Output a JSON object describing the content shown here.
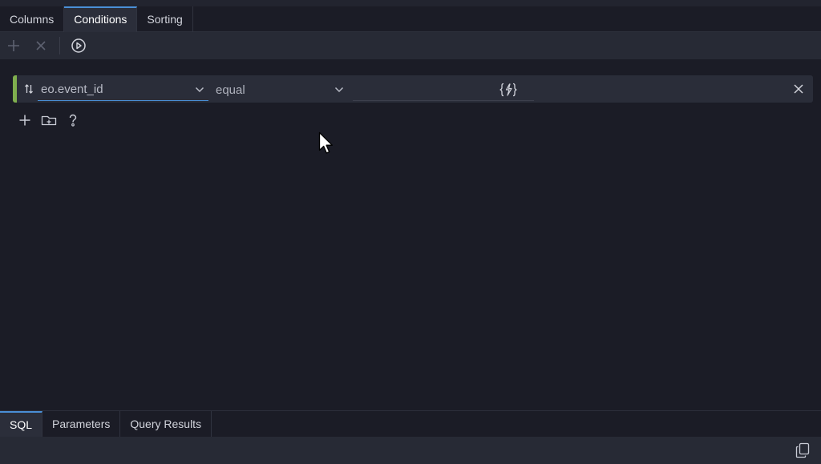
{
  "top_tabs": [
    {
      "label": "Columns",
      "active": false
    },
    {
      "label": "Conditions",
      "active": true
    },
    {
      "label": "Sorting",
      "active": false
    }
  ],
  "toolbar": {
    "add_icon": "plus-icon",
    "delete_icon": "close-icon",
    "run_icon": "play-circle-icon"
  },
  "condition": {
    "field": "eo.event_id",
    "operator": "equal",
    "value": "",
    "accent_color": "#7fae4e"
  },
  "actions": {
    "add_condition_icon": "plus-icon",
    "add_group_icon": "folder-plus-icon",
    "help_icon": "help-icon"
  },
  "bottom_tabs": [
    {
      "label": "SQL",
      "active": true
    },
    {
      "label": "Parameters",
      "active": false
    },
    {
      "label": "Query Results",
      "active": false
    }
  ],
  "colors": {
    "background": "#1b1c26",
    "panel": "#272a35",
    "active_tab_accent": "#4a8fd6"
  }
}
